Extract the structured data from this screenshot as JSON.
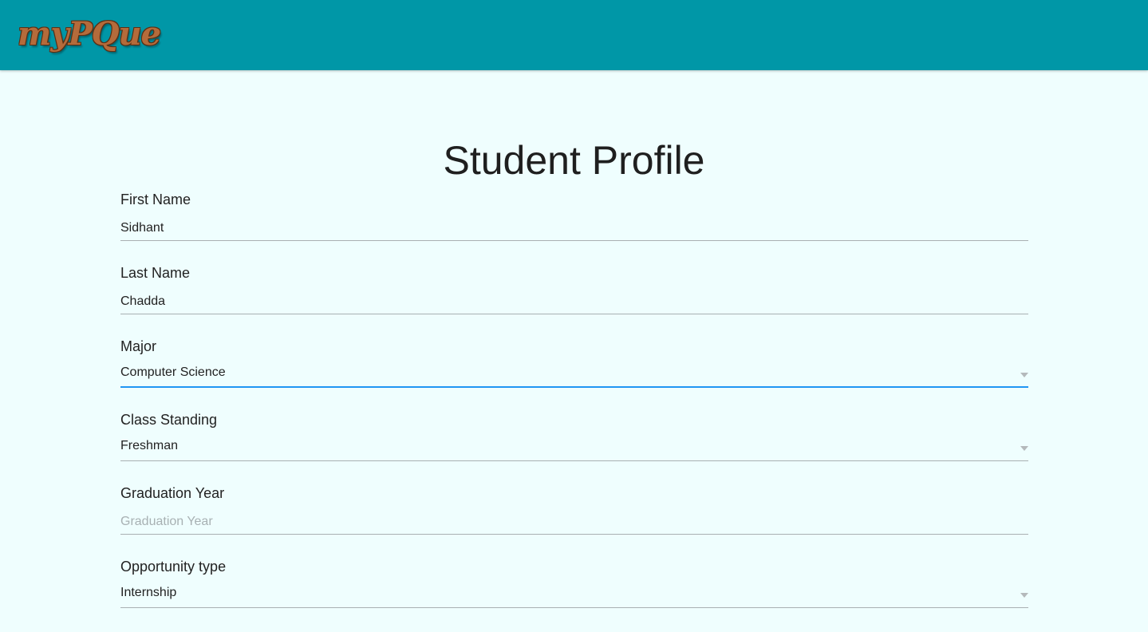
{
  "header": {
    "logo_text": "myPQue",
    "background_color": "#0097a7",
    "logo_color": "#b46b3b"
  },
  "page": {
    "title": "Student Profile",
    "background_color": "#effefe",
    "focus_color": "#2196f3"
  },
  "form": {
    "first_name": {
      "label": "First Name",
      "value": "Sidhant"
    },
    "last_name": {
      "label": "Last Name",
      "value": "Chadda"
    },
    "major": {
      "label": "Major",
      "value": "Computer Science",
      "icon": "chevron-down-icon"
    },
    "class_standing": {
      "label": "Class Standing",
      "value": "Freshman",
      "icon": "chevron-down-icon"
    },
    "graduation_year": {
      "label": "Graduation Year",
      "value": "",
      "placeholder": "Graduation Year"
    },
    "opportunity_type": {
      "label": "Opportunity type",
      "value": "Internship",
      "icon": "chevron-down-icon"
    }
  }
}
